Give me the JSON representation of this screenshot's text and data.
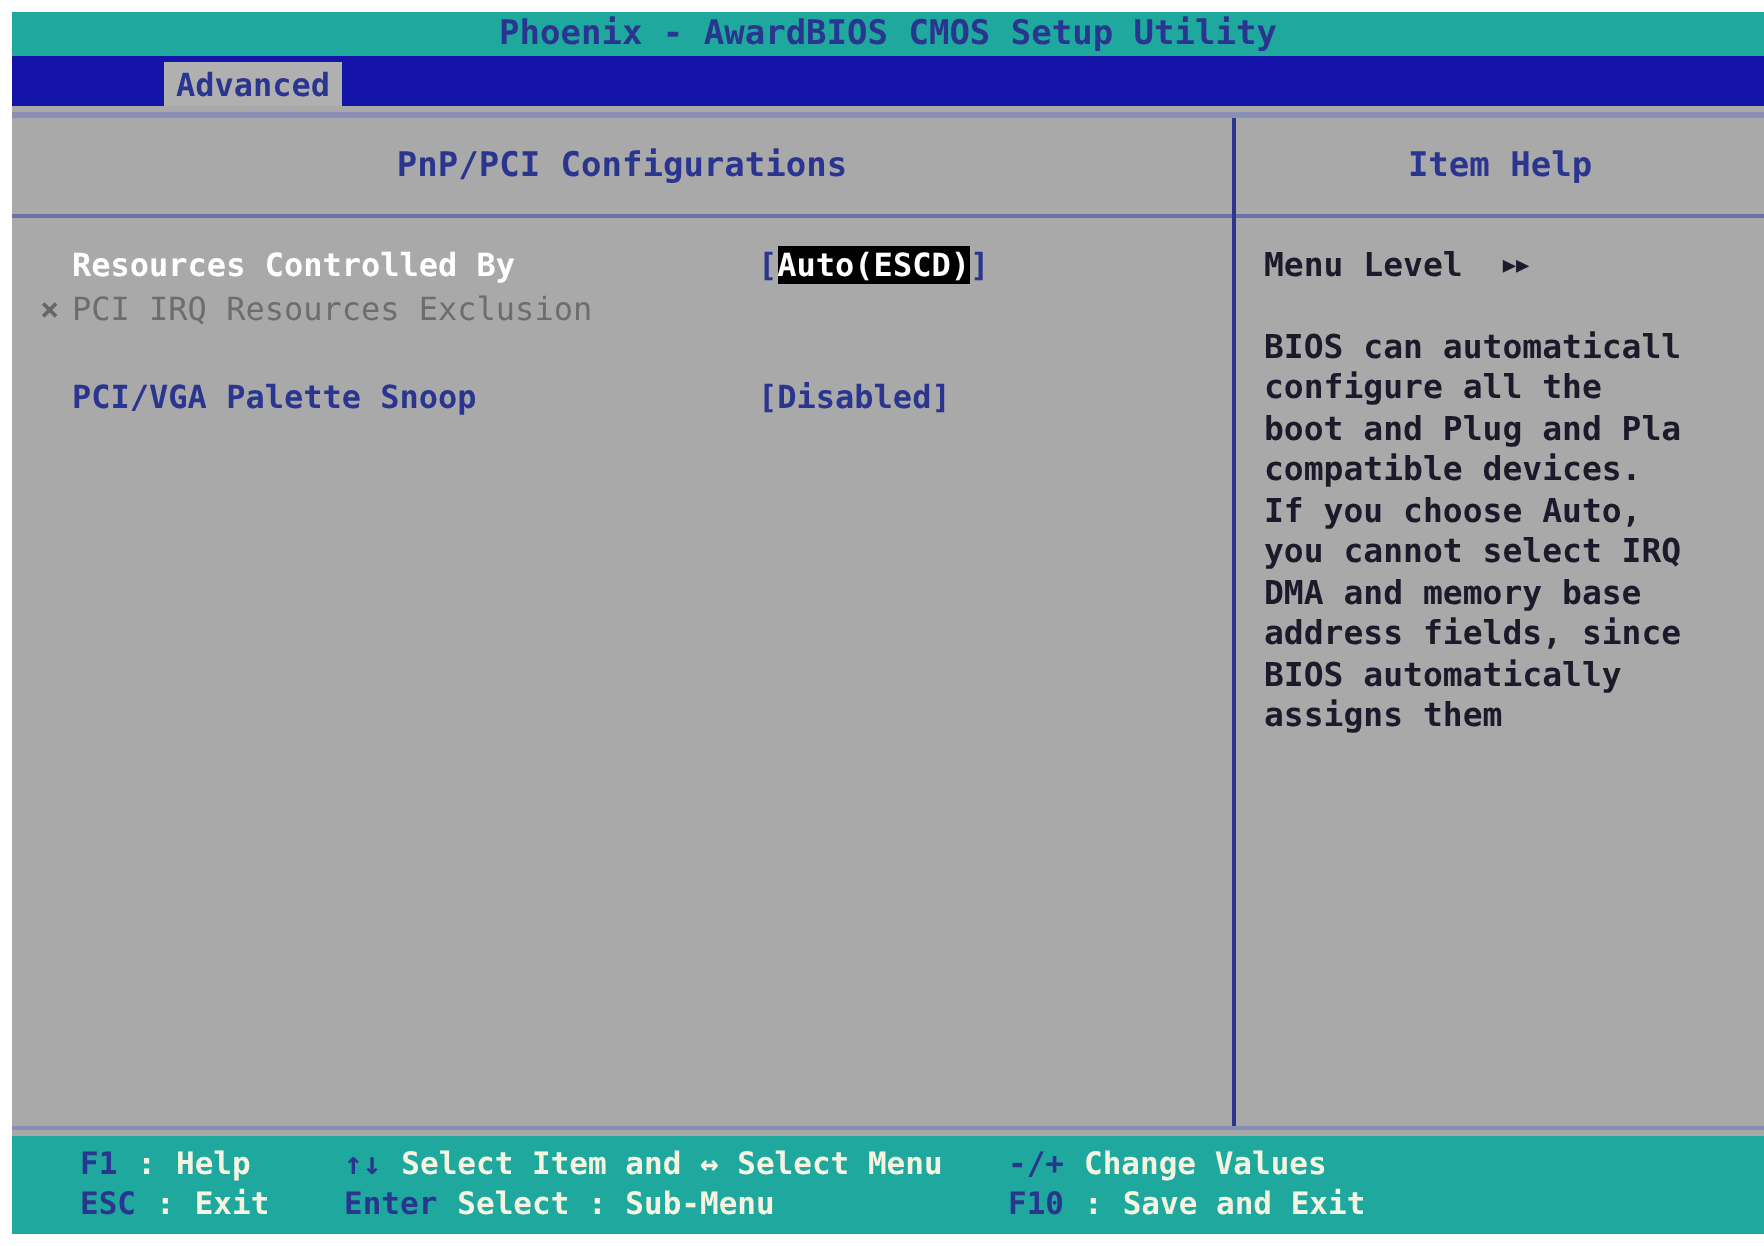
{
  "title": "Phoenix - AwardBIOS CMOS Setup Utility",
  "menu": [
    {
      "label": "Advanced",
      "selected": true
    }
  ],
  "main_panel": {
    "heading": "PnP/PCI Configurations",
    "items": [
      {
        "label": "Resources Controlled By",
        "value_prefix": "[",
        "value": "Auto(ESCD)",
        "value_suffix": "]",
        "selected": true,
        "disabled": false
      },
      {
        "marker": "×",
        "label": "PCI IRQ Resources Exclusion",
        "selected": false,
        "disabled": true
      },
      {
        "label": "PCI/VGA Palette Snoop",
        "value": "[Disabled]",
        "selected": false,
        "disabled": false
      }
    ]
  },
  "help_panel": {
    "heading": "Item Help",
    "menu_level": "Menu Level",
    "menu_level_mark": "▶▶",
    "lines": [
      "BIOS can automaticall",
      "configure all the",
      "boot and Plug and Pla",
      "compatible devices.",
      "If you choose Auto,",
      "you cannot select IRQ",
      "DMA and memory base",
      "address fields, since",
      "BIOS automatically",
      "assigns them"
    ]
  },
  "footer": [
    [
      {
        "key": "F1",
        "sep": ":",
        "desc": "Help"
      },
      {
        "key": "ESC",
        "sep": ":",
        "desc": "Exit"
      }
    ],
    [
      {
        "key": "↑↓",
        "desc": "Select Item and ↔ Select Menu"
      },
      {
        "key": "Enter",
        "desc": "Select : Sub-Menu"
      }
    ],
    [
      {
        "key": "-/+",
        "desc": "Change Values"
      },
      {
        "key": "F10",
        "sep": ":",
        "desc": "Save and Exit"
      }
    ]
  ]
}
